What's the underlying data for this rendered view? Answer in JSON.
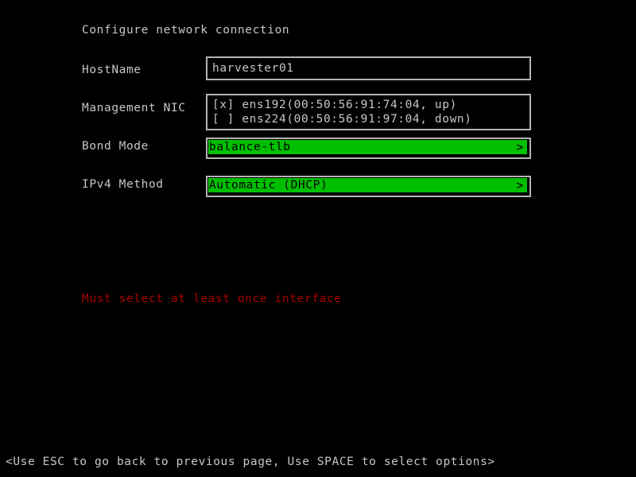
{
  "screen": {
    "title": "Configure network connection",
    "background_color": "#000000",
    "foreground_color": "#c6c6c6",
    "highlight_color": "#00bf00",
    "error_color": "#aa0000"
  },
  "form": {
    "hostname": {
      "label": "HostName",
      "value": "harvester01",
      "placeholder": "harvester01"
    },
    "management_nic": {
      "label": "Management NIC",
      "options": [
        {
          "checkbox": "[x]",
          "text": "ens192(00:50:56:91:74:04, up)"
        },
        {
          "checkbox": "[ ]",
          "text": "ens224(00:50:56:91:97:04, down)"
        }
      ]
    },
    "bond_mode": {
      "label": "Bond Mode",
      "value": "balance-tlb",
      "arrow": ">"
    },
    "ipv4_method": {
      "label": "IPv4 Method",
      "value": "Automatic (DHCP)",
      "arrow": ">"
    }
  },
  "error": {
    "message": "Must select at least once interface"
  },
  "footer": {
    "hint": "<Use ESC to go back to previous page, Use SPACE to select options>"
  }
}
